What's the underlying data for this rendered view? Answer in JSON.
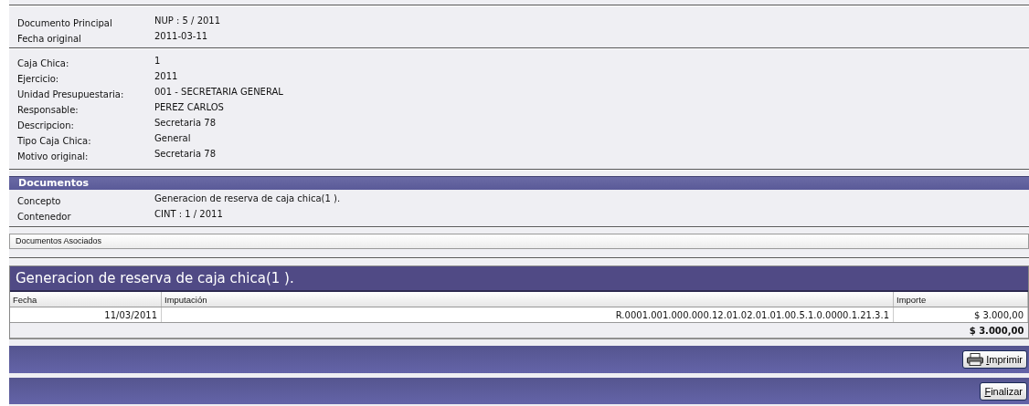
{
  "header_fields": [
    {
      "label": "Documento Principal",
      "value": "NUP : 5 / 2011"
    },
    {
      "label": "Fecha original",
      "value": "2011-03-11"
    }
  ],
  "caja_fields": [
    {
      "label": "Caja Chica:",
      "value": "1"
    },
    {
      "label": "Ejercicio:",
      "value": "2011"
    },
    {
      "label": "Unidad Presupuestaria:",
      "value": "001 - SECRETARIA GENERAL"
    },
    {
      "label": "Responsable:",
      "value": "PEREZ CARLOS"
    },
    {
      "label": "Descripcion:",
      "value": "Secretaria 78"
    },
    {
      "label": "Tipo Caja Chica:",
      "value": "General"
    },
    {
      "label": "Motivo original:",
      "value": "Secretaria 78"
    }
  ],
  "documentos": {
    "title": "Documentos",
    "fields": [
      {
        "label": "Concepto",
        "value": "Generacion de reserva de caja chica(1 )."
      },
      {
        "label": "Contenedor",
        "value": "CINT : 1 / 2011"
      }
    ]
  },
  "documentos_asociados": {
    "label": "Documentos Asociados"
  },
  "table": {
    "title": "Generacion de reserva de caja chica(1 ).",
    "columns": [
      "Fecha",
      "Imputación",
      "Importe"
    ],
    "rows": [
      [
        "11/03/2011",
        "R.0001.001.000.000.12.01.02.01.01.00.5.1.0.0000.1.21.3.1",
        "$ 3.000,00"
      ]
    ],
    "total": "$ 3.000,00"
  },
  "buttons": [
    {
      "label": "Imprimir",
      "kind": "print"
    },
    {
      "label": "Finalizar",
      "kind": "plain"
    }
  ]
}
